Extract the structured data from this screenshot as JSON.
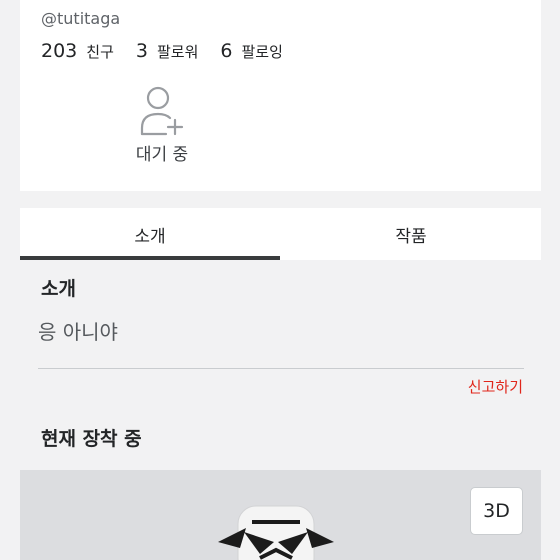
{
  "profile": {
    "username": "@tutitaga",
    "stats": [
      {
        "num": "203",
        "label": "친구"
      },
      {
        "num": "3",
        "label": "팔로워"
      },
      {
        "num": "6",
        "label": "팔로잉"
      }
    ],
    "pending_label": "대기 중",
    "pending_icon": "add-friend-icon"
  },
  "tabs": [
    {
      "label": "소개",
      "active": true
    },
    {
      "label": "작품",
      "active": false
    }
  ],
  "about": {
    "title": "소개",
    "text": "응 아니야",
    "report_label": "신고하기"
  },
  "wearing": {
    "title": "현재 장착 중",
    "view_3d_label": "3D"
  },
  "colors": {
    "background": "#f2f2f3",
    "card": "#ffffff",
    "report": "#e0261b",
    "tab_underline": "#393b3d"
  }
}
